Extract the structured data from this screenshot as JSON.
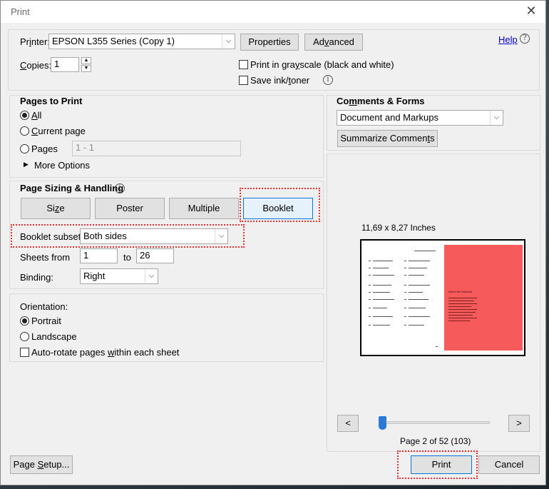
{
  "window": {
    "title": "Print",
    "close_glyph": "✕"
  },
  "printer": {
    "label_pre": "Pr",
    "label_u": "i",
    "label_post": "nter:",
    "selected": "EPSON L355 Series (Copy 1)",
    "properties_label": "Properties",
    "advanced_pre": "Ad",
    "advanced_u": "v",
    "advanced_post": "anced"
  },
  "help": {
    "label": "Help"
  },
  "copies": {
    "label_u": "C",
    "label_post": "opies:",
    "value": "1"
  },
  "options": {
    "grayscale_pre": "Print in gra",
    "grayscale_u": "y",
    "grayscale_post": "scale (black and white)",
    "save_ink_pre": "Save ink/",
    "save_ink_u": "t",
    "save_ink_post": "oner"
  },
  "pages_to_print": {
    "title": "Pages to Print",
    "all_u": "A",
    "all_post": "ll",
    "current_u": "C",
    "current_post": "urrent page",
    "pages_label": "Pages",
    "pages_placeholder": "1 - 1",
    "more_options": "More Options"
  },
  "sizing": {
    "title": "Page Sizing & Handling",
    "size_pre": "Si",
    "size_u": "z",
    "size_post": "e",
    "poster_label": "Poster",
    "multiple_label": "Multiple",
    "booklet_label": "Booklet",
    "booklet_subset_label": "Booklet subset:",
    "booklet_subset_value": "Both sides",
    "sheets_from_label": "Sheets from",
    "sheets_from": "1",
    "sheets_to_label": "to",
    "sheets_to": "26",
    "binding_label": "Binding:",
    "binding_value": "Right"
  },
  "orientation": {
    "title": "Orientation:",
    "portrait_label": "Portrait",
    "landscape_label": "Landscape",
    "autorotate_pre": "Auto-rotate pages ",
    "autorotate_u": "w",
    "autorotate_post": "ithin each sheet"
  },
  "comments": {
    "title_pre": "Co",
    "title_u": "m",
    "title_post": "ments & Forms",
    "selected": "Document and Markups",
    "summarize_pre": "Summarize Commen",
    "summarize_u": "t",
    "summarize_post": "s"
  },
  "preview": {
    "size_text": "11,69 x 8,27 Inches",
    "page_text": "Page 2 of 52 (103)",
    "prev": "<",
    "next": ">",
    "right_heading": "About the Manuals"
  },
  "footer": {
    "page_setup_pre": "Page ",
    "page_setup_u": "S",
    "page_setup_post": "etup...",
    "print_label": "Print",
    "cancel_label": "Cancel"
  },
  "colors": {
    "highlight": "#e0312f",
    "preview_page": "#f65a5a",
    "slider": "#2b7bd6"
  }
}
